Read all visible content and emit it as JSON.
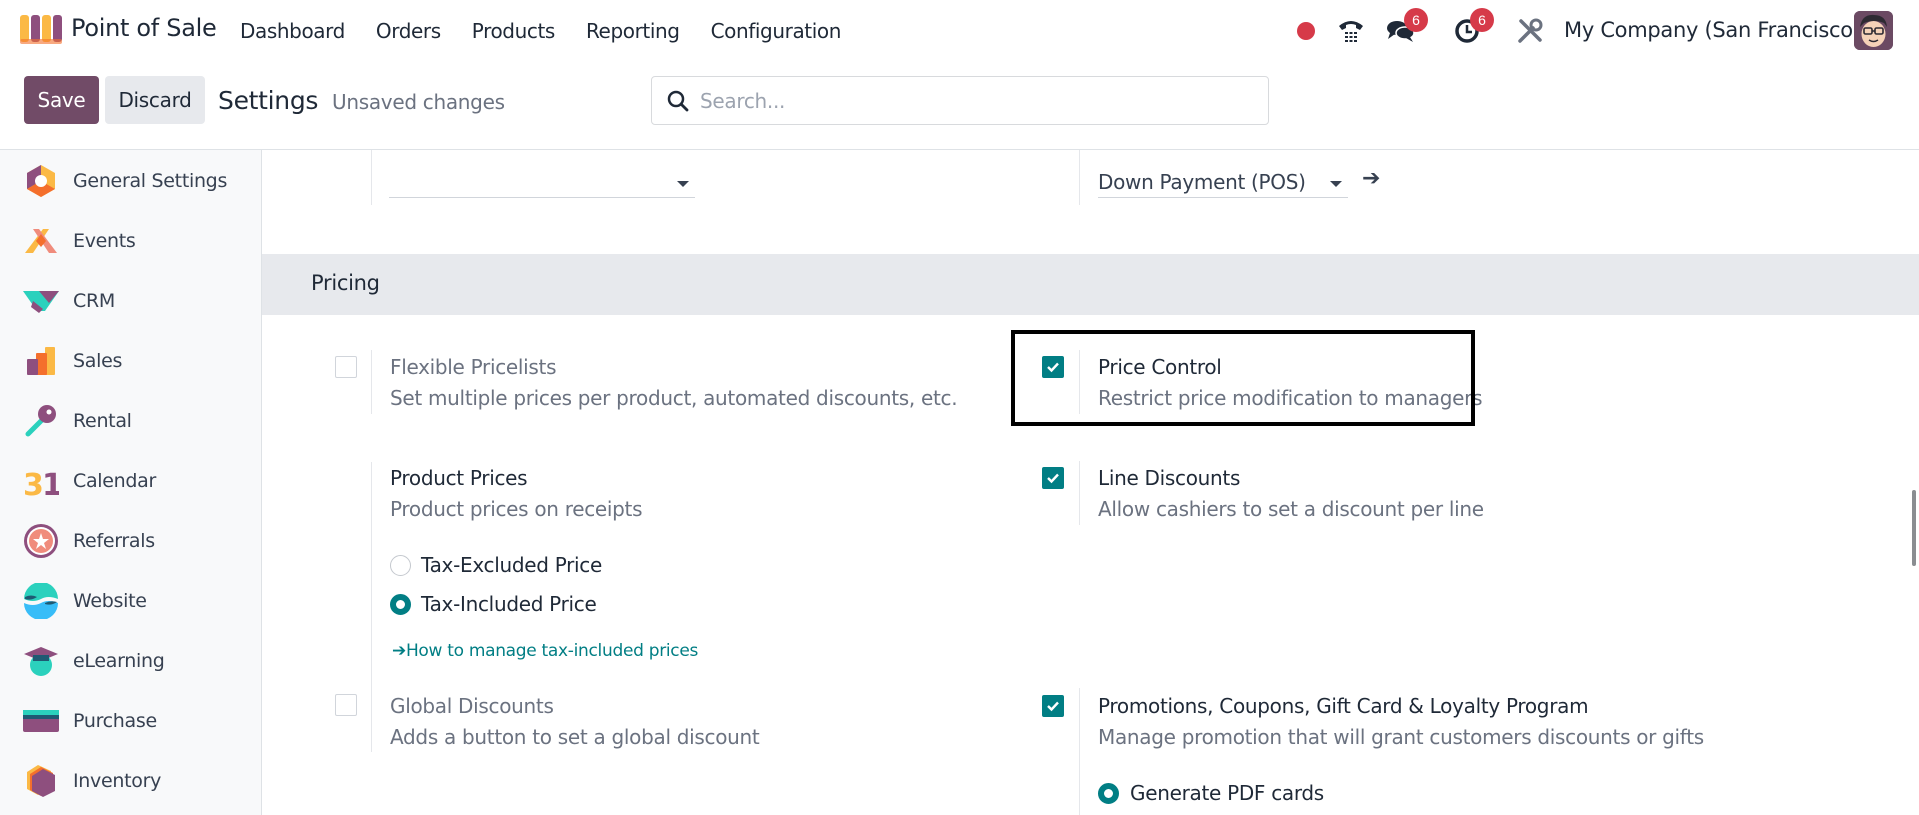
{
  "navbar": {
    "app_name": "Point of Sale",
    "menu": [
      "Dashboard",
      "Orders",
      "Products",
      "Reporting",
      "Configuration"
    ],
    "messages_badge": "6",
    "activities_badge": "6",
    "company": "My Company (San Francisco)",
    "icons": [
      "recording-dot-icon",
      "phone-icon",
      "chat-icon",
      "clock-icon",
      "tools-icon"
    ]
  },
  "control_panel": {
    "save_label": "Save",
    "discard_label": "Discard",
    "title": "Settings",
    "status": "Unsaved changes",
    "search_placeholder": "Search..."
  },
  "sidebar": {
    "items": [
      {
        "label": "General Settings",
        "icon": "general-settings-icon"
      },
      {
        "label": "Events",
        "icon": "events-icon"
      },
      {
        "label": "CRM",
        "icon": "crm-icon"
      },
      {
        "label": "Sales",
        "icon": "sales-icon"
      },
      {
        "label": "Rental",
        "icon": "rental-icon"
      },
      {
        "label": "Calendar",
        "icon": "calendar-icon"
      },
      {
        "label": "Referrals",
        "icon": "referrals-icon"
      },
      {
        "label": "Website",
        "icon": "website-icon"
      },
      {
        "label": "eLearning",
        "icon": "elearning-icon"
      },
      {
        "label": "Purchase",
        "icon": "purchase-icon"
      },
      {
        "label": "Inventory",
        "icon": "inventory-icon"
      }
    ]
  },
  "top_fields": {
    "left_dropdown_value": "",
    "right_dropdown_value": "Down Payment (POS)"
  },
  "pricing": {
    "section_title": "Pricing",
    "flexible_pricelists": {
      "title": "Flexible Pricelists",
      "desc": "Set multiple prices per product, automated discounts, etc.",
      "checked": false
    },
    "price_control": {
      "title": "Price Control",
      "desc": "Restrict price modification to managers",
      "checked": true
    },
    "product_prices": {
      "title": "Product Prices",
      "desc": "Product prices on receipts",
      "options": [
        "Tax-Excluded Price",
        "Tax-Included Price"
      ],
      "selected": "Tax-Included Price",
      "link": "How to manage tax-included prices"
    },
    "line_discounts": {
      "title": "Line Discounts",
      "desc": "Allow cashiers to set a discount per line",
      "checked": true
    },
    "global_discounts": {
      "title": "Global Discounts",
      "desc": "Adds a button to set a global discount",
      "checked": false
    },
    "promotions": {
      "title": "Promotions, Coupons, Gift Card & Loyalty Program",
      "desc": "Manage promotion that will grant customers discounts or gifts",
      "checked": true,
      "option": "Generate PDF cards"
    }
  },
  "colors": {
    "brand": "#714b67",
    "accent": "#017e84",
    "badge": "#d63a49"
  }
}
